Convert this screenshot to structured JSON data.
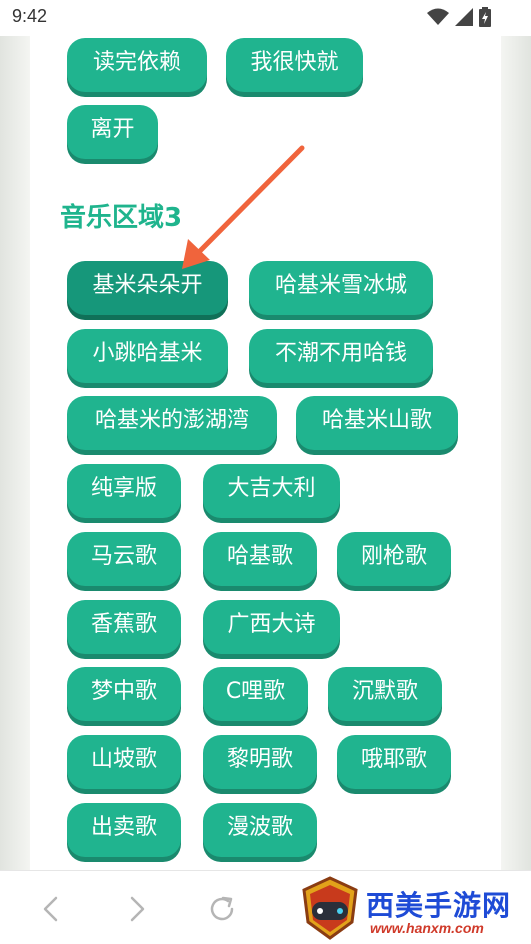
{
  "status_bar": {
    "time": "9:42"
  },
  "section": {
    "title": "音乐区域3"
  },
  "chips_top": [
    "读完依赖",
    "我很快就",
    "离开"
  ],
  "chips": [
    "基米朵朵开",
    "哈基米雪冰城",
    "小跳哈基米",
    "不潮不用哈钱",
    "哈基米的澎湖湾",
    "哈基米山歌",
    "纯享版",
    "大吉大利",
    "马云歌",
    "哈基歌",
    "刚枪歌",
    "香蕉歌",
    "广西大诗",
    "梦中歌",
    "C哩歌",
    "沉默歌",
    "山坡歌",
    "黎明歌",
    "哦耶歌",
    "出卖歌",
    "漫波歌"
  ],
  "active_chip": "基米朵朵开",
  "nav": {
    "back_icon": "chevron-left-icon",
    "forward_icon": "chevron-right-icon",
    "reload_icon": "reload-icon"
  },
  "watermark": {
    "title": "西美手游网",
    "url": "www.hanxm.com"
  },
  "colors": {
    "chip": "#20b48f",
    "chip_active": "#16977a",
    "title": "#1fb48d",
    "arrow": "#f0643c",
    "watermark_title": "#1e4bd6",
    "watermark_url": "#d03a2a"
  }
}
